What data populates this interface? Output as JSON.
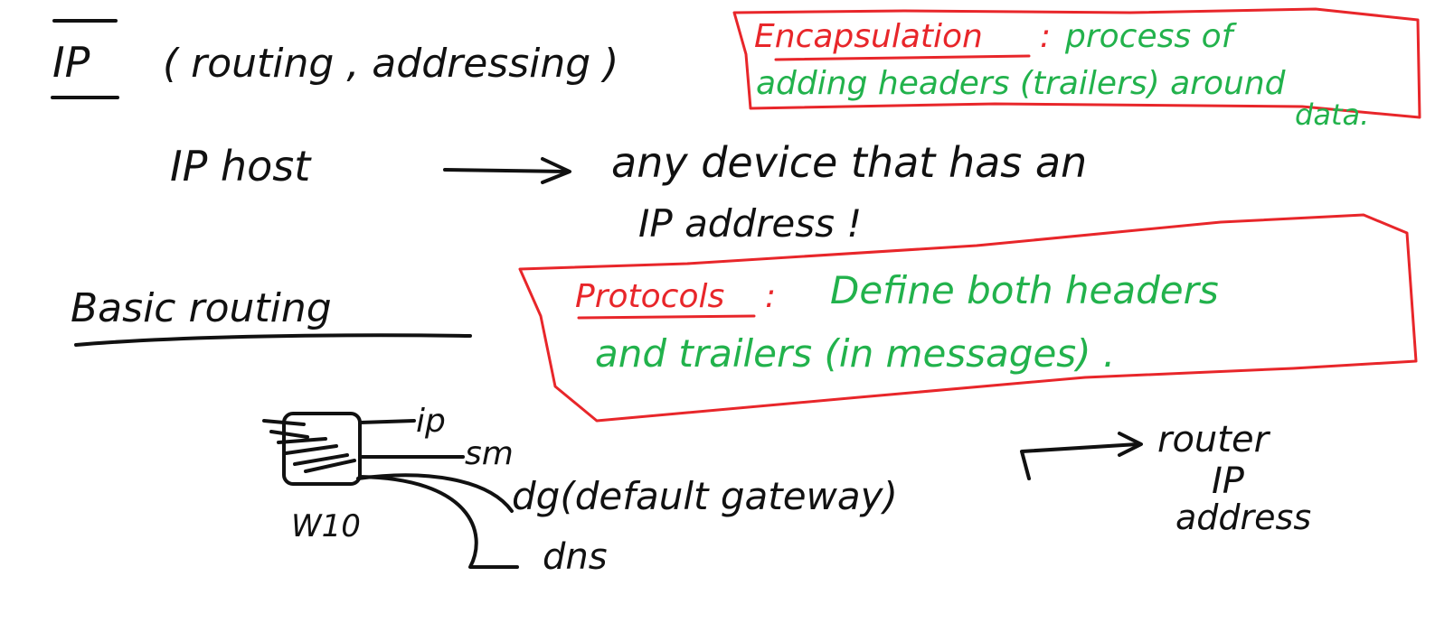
{
  "notes": {
    "heading_ip": "IP",
    "heading_ip_detail": "( routing , addressing )",
    "ip_host_term": "IP host",
    "ip_host_definition_line1": "any device that has an",
    "ip_host_definition_line2": "IP address !",
    "basic_routing": "Basic routing",
    "encapsulation_term": "Encapsulation",
    "encapsulation_colon": ":",
    "encapsulation_def_line1": "process of",
    "encapsulation_def_line2": "adding headers (trailers) around",
    "encapsulation_def_line3": "data.",
    "protocols_term": "Protocols",
    "protocols_colon": ":",
    "protocols_def_line1": "Define both headers",
    "protocols_def_line2": "and trailers (in messages) .",
    "pc_label": "W10",
    "branch_ip": "ip",
    "branch_sm": "sm",
    "branch_dg": "dg(default gateway)",
    "branch_dns": "dns",
    "router_line1": "router",
    "router_line2": "IP",
    "router_line3": "address"
  },
  "colors": {
    "ink_black": "#111111",
    "ink_red": "#e8262a",
    "ink_green": "#22b24c",
    "background": "#ffffff"
  }
}
